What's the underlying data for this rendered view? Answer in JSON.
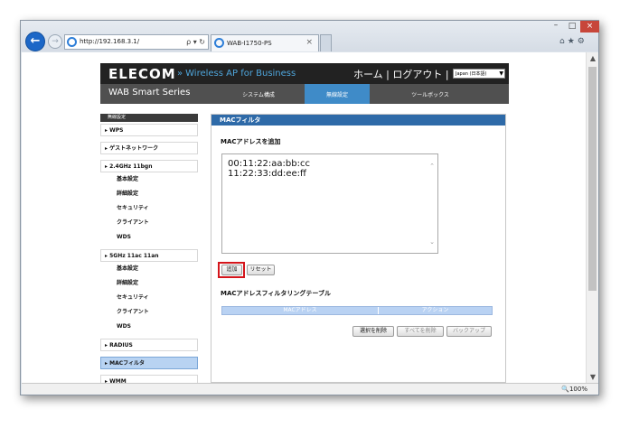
{
  "browser": {
    "url": "http://192.168.3.1/",
    "tab_title": "WAB-I1750-PS",
    "zoom": "🔍100%",
    "tab_close": "×",
    "addr_tools": "ρ ▾ ↻"
  },
  "window_controls": {
    "minimize": "–",
    "maximize": "□",
    "close": "×"
  },
  "right_icons": "⌂★⚙",
  "header": {
    "logo": "ELECOM",
    "chevron": "»",
    "tagline": "Wireless AP for Business",
    "links": "ホーム | ログアウト |",
    "language": "Japan (日本語)"
  },
  "nav": {
    "series": "WAB Smart Series",
    "items": [
      "システム構成",
      "無線設定",
      "ツールボックス"
    ],
    "active_index": 1
  },
  "sidebar": {
    "heading": "無線設定",
    "items": [
      {
        "label": "▸ WPS",
        "kind": "section"
      },
      {
        "label": "▸ ゲストネットワーク",
        "kind": "section"
      },
      {
        "label": "▸ 2.4GHz 11bgn",
        "kind": "section"
      },
      {
        "label": "基本設定",
        "kind": "sub"
      },
      {
        "label": "詳細設定",
        "kind": "sub"
      },
      {
        "label": "セキュリティ",
        "kind": "sub"
      },
      {
        "label": "クライアント",
        "kind": "sub"
      },
      {
        "label": "WDS",
        "kind": "sub"
      },
      {
        "label": "▸ 5GHz 11ac 11an",
        "kind": "section"
      },
      {
        "label": "基本設定",
        "kind": "sub"
      },
      {
        "label": "詳細設定",
        "kind": "sub"
      },
      {
        "label": "セキュリティ",
        "kind": "sub"
      },
      {
        "label": "クライアント",
        "kind": "sub"
      },
      {
        "label": "WDS",
        "kind": "sub"
      },
      {
        "label": "▸ RADIUS",
        "kind": "section"
      },
      {
        "label": "▸ MACフィルタ",
        "kind": "section",
        "active": true
      },
      {
        "label": "▸ WMM",
        "kind": "section"
      }
    ]
  },
  "panel": {
    "title": "MACフィルタ",
    "add_section_title": "MACアドレスを追加",
    "mac_lines": [
      "00:11:22:aa:bb:cc",
      "11:22:33:dd:ee:ff"
    ],
    "add_button": "追加",
    "reset_button": "リセット",
    "table_title": "MACアドレスフィルタリングテーブル",
    "table_headers": [
      "MACアドレス",
      "アクション"
    ],
    "delete_selected": "選択を削除",
    "delete_all": "すべてを削除",
    "backup": "バックアップ"
  },
  "colors": {
    "header_bg": "#222222",
    "nav_bg": "#505050",
    "nav_active": "#3f8bc8",
    "tagline": "#4fa6dc",
    "panel_head": "#2e6aa8",
    "sidebar_active": "#b8d3f2",
    "table_header": "#b9d2f3",
    "highlight": "#d4151b"
  }
}
